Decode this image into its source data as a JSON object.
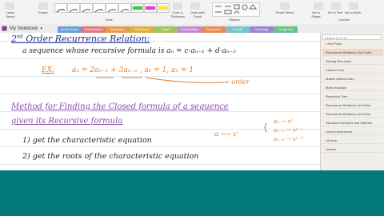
{
  "ribbon": {
    "group1": {
      "items": [
        "Lasso Select",
        "Eraser"
      ],
      "label": "Tools"
    },
    "group2": {
      "label": "Tools"
    },
    "group3": {
      "items": [
        "Color & Thickness",
        "Draw with Touch"
      ]
    },
    "group4": {
      "items": [
        "Insert Space"
      ],
      "label": "Shapes"
    },
    "group5": {
      "items": [
        "Ink to Shape",
        "Ink to Text",
        "Ink to Math"
      ],
      "label": "Convert"
    },
    "group6": {
      "items": [
        "Smart Select"
      ]
    }
  },
  "notebook": {
    "name": "My Notebook"
  },
  "tabs": [
    {
      "label": "Quick Notes",
      "color": "#6aa0d6"
    },
    {
      "label": "Preliminaries",
      "color": "#e07a7a"
    },
    {
      "label": "Relations",
      "color": "#e59a4d"
    },
    {
      "label": "Functions",
      "color": "#d9b13f"
    },
    {
      "label": "Graph Theory",
      "color": "#a0c45a"
    },
    {
      "label": "Probabilities",
      "color": "#c28ad3"
    },
    {
      "label": "Recursion",
      "color": "#e88a54"
    },
    {
      "label": "Proofs",
      "color": "#7ac4c4"
    },
    {
      "label": "Counting",
      "color": "#9a86d0"
    },
    {
      "label": "Graph Alg",
      "color": "#6fbf8a"
    }
  ],
  "sidebar": {
    "search_placeholder": "Search (Ctrl+E)",
    "add_page": "+ Add Page",
    "pages": [
      {
        "label": "Recurrence Relations 2nd Order",
        "selected": true
      },
      {
        "label": "Solving Recursion",
        "selected": false
      },
      {
        "label": "Closed-Form",
        "selected": false
      },
      {
        "label": "Master Method Intro",
        "selected": false
      },
      {
        "label": "Math Induction",
        "selected": false
      },
      {
        "label": "Recursion Tree",
        "selected": false
      },
      {
        "label": "Recurrence Relations 1st Order",
        "selected": false
      },
      {
        "label": "Recurrence Relations 1st Order",
        "selected": false
      },
      {
        "label": "Fibonacci Numbers and Patterns",
        "selected": false
      },
      {
        "label": "Linear recurrences",
        "selected": false
      },
      {
        "label": "Lift thus",
        "selected": false
      },
      {
        "label": "Lecture",
        "selected": false
      }
    ]
  },
  "notes": {
    "title_num": "2",
    "title_sup": "nd",
    "title_rest": " Order Recurrence Relation:",
    "def": "a sequence whose recursive formula is  aₙ = c·aₙ₋₁ + d·aₙ₋₂",
    "ex_label": "EX:",
    "ex_eq": "aₙ = 2aₙ₋₁ + 3aₙ₋₂ ,  a₀ = 1,  a₁ = 1",
    "order_note": "= order",
    "method_line1": "Method for Finding the Closed formula of a sequence",
    "method_line2": "given its Recursive formula",
    "step1": "1)  get the characteristic equation",
    "step2": "2)  get the roots of the characteristic equation",
    "map_left": "aᵢ ⟷ xⁱ",
    "map_r1": "aₙ → xⁿ",
    "map_r2": "aₙ₋₁ → xⁿ⁻¹",
    "map_r3": "aₙ₋₂ → xⁿ⁻²"
  }
}
